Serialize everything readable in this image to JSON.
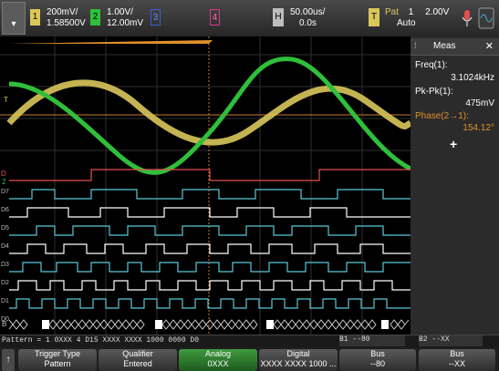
{
  "header": {
    "ch1": {
      "num": "1",
      "scale": "200mV/",
      "offset": "1.58500V",
      "color": "#d9c75a"
    },
    "ch2": {
      "num": "2",
      "scale": "1.00V/",
      "offset": "12.00mV",
      "color": "#2fbf3a"
    },
    "ch3": {
      "num": "3",
      "color": "#3b5bdb"
    },
    "ch4": {
      "num": "4",
      "color": "#d33b8a"
    },
    "horizontal": {
      "badge": "H",
      "scale": "50.00us/",
      "delay": "0.0s"
    },
    "trigger": {
      "badge": "T",
      "mode_label": "Pat",
      "source": "1",
      "level": "2.00V",
      "sweep": "Auto"
    }
  },
  "meas": {
    "title": "Meas",
    "items": [
      {
        "label": "Freq(1):",
        "value": "3.1024kHz"
      },
      {
        "label": "Pk-Pk(1):",
        "value": "475mV"
      },
      {
        "label": "Phase(2→1):",
        "value": "154.12°"
      }
    ],
    "add": "+"
  },
  "status": {
    "pattern": "Pattern = 1 0XXX 4 D15 XXXX XXXX 1000 0000 D0",
    "b1": "B1 --80",
    "b2": "B2 --XX"
  },
  "softkeys": [
    {
      "top": "Trigger Type",
      "bottom": "Pattern"
    },
    {
      "top": "Qualifier",
      "bottom": "Entered"
    },
    {
      "top": "Analog",
      "bottom": "0XXX"
    },
    {
      "top": "Digital",
      "bottom": "XXXX XXXX 1000 ..."
    },
    {
      "top": "Bus",
      "bottom": "--80"
    },
    {
      "top": "Bus",
      "bottom": "--XX"
    }
  ],
  "digital_labels": [
    "D7",
    "D6",
    "D5",
    "D4",
    "D3",
    "D2",
    "D1",
    "D0"
  ],
  "bus_label": "B",
  "icons": {
    "menu": "chevron-down-icon",
    "mic": "microphone-icon",
    "home": "arrow-up-icon"
  }
}
